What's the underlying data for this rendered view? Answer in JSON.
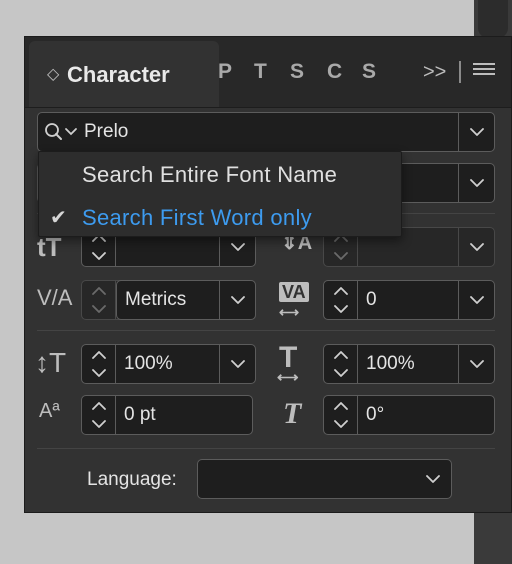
{
  "panel": {
    "title": "Character",
    "tab_letters": [
      "P",
      "T",
      "S",
      "C",
      "S"
    ],
    "more_tabs_label": ">>"
  },
  "font_search": {
    "value": "Prelo",
    "menu": {
      "items": [
        {
          "label": "Search Entire Font Name",
          "checked": false
        },
        {
          "label": "Search First Word only",
          "checked": true
        }
      ],
      "checkmark": "✔"
    }
  },
  "controls": {
    "kerning_value": "Metrics",
    "tracking_value": "0",
    "vertical_scale_value": "100%",
    "horizontal_scale_value": "100%",
    "baseline_shift_value": "0 pt",
    "skew_value": "0°"
  },
  "language": {
    "label": "Language:",
    "value": ""
  },
  "colors": {
    "highlight_text": "#3d9bef",
    "text": "#e0e0e0",
    "panel_bg": "#323232"
  },
  "icons": [
    "search-icon",
    "chevron-down-icon",
    "panel-menu-icon",
    "leading-icon",
    "kerning-icon",
    "tracking-icon",
    "vertical-scale-icon",
    "horizontal-scale-icon",
    "baseline-shift-icon",
    "skew-icon",
    "checkmark-icon"
  ]
}
